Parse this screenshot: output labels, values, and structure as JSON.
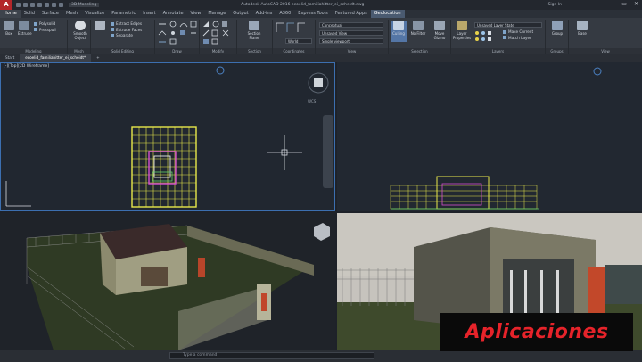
{
  "titlebar": {
    "app_logo": "A",
    "workspace": "3D Modeling",
    "title": "Autodesk AutoCAD 2016   ecoelid_familiahitter_ei_scheidt.dwg",
    "sign_in": "Sign In",
    "buttons": [
      "—",
      "▭",
      "✕"
    ]
  },
  "ribbon_tabs": [
    "Home",
    "Solid",
    "Surface",
    "Mesh",
    "Visualize",
    "Parametric",
    "Insert",
    "Annotate",
    "View",
    "Manage",
    "Output",
    "Add-ins",
    "A360",
    "Express Tools",
    "Featured Apps",
    "Geolocation"
  ],
  "ribbon": {
    "panels": [
      {
        "label": "Modeling",
        "big": [
          "Box",
          "Extrude"
        ],
        "smalls": [
          "Polysolid",
          "Presspull"
        ]
      },
      {
        "label": "Mesh",
        "big": [
          "Smooth Object"
        ],
        "smalls": []
      },
      {
        "label": "Solid Editing",
        "big": [],
        "smalls": [
          "Extract Edges",
          "Extrude Faces",
          "Separate"
        ]
      },
      {
        "label": "Draw",
        "big": [],
        "smalls": []
      },
      {
        "label": "Modify",
        "big": [],
        "smalls": []
      },
      {
        "label": "Section",
        "big": [
          "Section Plane"
        ],
        "smalls": []
      },
      {
        "label": "Coordinates",
        "big": [],
        "smalls": [
          "World"
        ]
      },
      {
        "label": "View",
        "big": [],
        "smalls": [
          "Conceptual",
          "Unsaved View",
          "Single viewport"
        ]
      },
      {
        "label": "Selection",
        "big": [
          "Culling",
          "No Filter",
          "Move Gizmo"
        ],
        "smalls": []
      },
      {
        "label": "Layers",
        "big": [
          "Layer Properties"
        ],
        "smalls": [
          "Make Current",
          "Match Layer"
        ],
        "dropdown": "Unsaved Layer State"
      },
      {
        "label": "Groups",
        "big": [
          "Group"
        ],
        "smalls": []
      },
      {
        "label": "View",
        "big": [
          "Base"
        ],
        "smalls": []
      }
    ]
  },
  "file_tabs": [
    "Start",
    "ecoelid_familiahitter_ei_scheidt*"
  ],
  "viewports": {
    "top_left_label": "[-][Top][2D Wireframe]",
    "viewcube_label": "WCS"
  },
  "command_line": {
    "placeholder": "Type a command"
  },
  "banner": {
    "text": "Aplicaciones"
  },
  "colors": {
    "accent": "#3c6fb0",
    "banner_text": "#e6232a",
    "plan_yellow": "#e8e84a",
    "plan_magenta": "#d64fd1"
  }
}
